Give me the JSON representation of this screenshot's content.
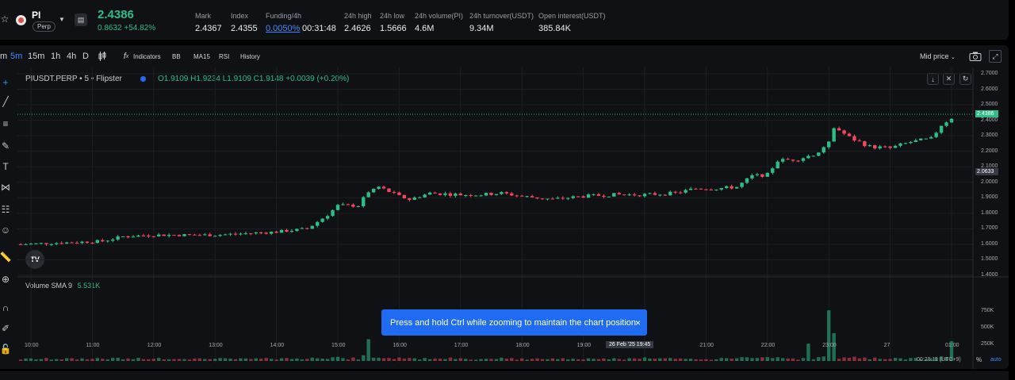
{
  "header": {
    "symbol": "PI",
    "contract_type": "Perp",
    "last_price": "2.4386",
    "change": "0.8632 +54.82%",
    "metrics": [
      {
        "label": "Mark",
        "value": "2.4367"
      },
      {
        "label": "Index",
        "value": "2.4355"
      },
      {
        "label": "Funding/4h",
        "value": "0.0050%",
        "countdown": "00:31:48"
      },
      {
        "label": "24h high",
        "value": "2.4626"
      },
      {
        "label": "24h low",
        "value": "1.5666"
      },
      {
        "label": "24h volume(PI)",
        "value": "4.6M"
      },
      {
        "label": "24h turnover(USDT)",
        "value": "9.34M"
      },
      {
        "label": "Open interest(USDT)",
        "value": "385.84K"
      }
    ]
  },
  "toolbar": {
    "timeframes": [
      "m",
      "5m",
      "15m",
      "1h",
      "4h",
      "D"
    ],
    "active_timeframe": "5m",
    "indicators_label": "Indicators",
    "studies": [
      "BB",
      "MA15",
      "RSI",
      "History"
    ],
    "price_mode": "Mid price"
  },
  "legend": {
    "title": "PIUSDT.PERP • 5 • Flipster",
    "ohlc": "O1.9109 H1.9234 L1.9109 C1.9148 +0.0039 (+0.20%)",
    "volume_label": "Volume SMA 9",
    "volume_value": "5.531K"
  },
  "price_axis": {
    "ticks": [
      "2.7000",
      "2.6000",
      "2.5000",
      "2.4000",
      "2.3000",
      "2.2000",
      "2.1000",
      "2.0000",
      "1.9000",
      "1.8000",
      "1.7000",
      "1.6000",
      "1.5000",
      "1.4000"
    ],
    "last_price_tag": "2.4386",
    "crosshair_tag": "2.0633"
  },
  "volume_axis": {
    "ticks": [
      "750K",
      "500K",
      "250K"
    ]
  },
  "time_axis": {
    "ticks": [
      "10:00",
      "11:00",
      "12:00",
      "13:00",
      "14:00",
      "15:00",
      "16:00",
      "17:00",
      "18:00",
      "19:00",
      "21:00",
      "22:00",
      "23:00",
      "27",
      "01:00"
    ],
    "crosshair_label": "26 Feb '25   19:45"
  },
  "footer": {
    "clock": "00:28:11 (UTC+9)",
    "percent": "%",
    "auto": "auto"
  },
  "toast": {
    "message": "Press and hold Ctrl while zooming to maintain the chart position",
    "close": "×"
  },
  "colors": {
    "up": "#2ebd85",
    "down": "#f6465d",
    "panel": "#101114",
    "accent": "#1f6bf2"
  },
  "chart_data": {
    "type": "candlestick",
    "symbol": "PIUSDT.PERP",
    "interval": "5",
    "ylim": [
      1.4,
      2.7
    ],
    "close_path": [
      [
        "09:50",
        1.6
      ],
      [
        "10:30",
        1.61
      ],
      [
        "11:10",
        1.62
      ],
      [
        "11:30",
        1.65
      ],
      [
        "12:00",
        1.66
      ],
      [
        "12:30",
        1.66
      ],
      [
        "13:00",
        1.66
      ],
      [
        "13:30",
        1.67
      ],
      [
        "14:00",
        1.68
      ],
      [
        "14:30",
        1.7
      ],
      [
        "14:50",
        1.79
      ],
      [
        "15:00",
        1.85
      ],
      [
        "15:20",
        1.85
      ],
      [
        "15:30",
        1.94
      ],
      [
        "15:40",
        1.97
      ],
      [
        "16:00",
        1.91
      ],
      [
        "16:10",
        1.89
      ],
      [
        "16:30",
        1.93
      ],
      [
        "17:00",
        1.92
      ],
      [
        "17:20",
        1.92
      ],
      [
        "17:40",
        1.93
      ],
      [
        "18:00",
        1.91
      ],
      [
        "18:30",
        1.89
      ],
      [
        "19:00",
        1.91
      ],
      [
        "19:30",
        1.92
      ],
      [
        "20:00",
        1.92
      ],
      [
        "20:30",
        1.93
      ],
      [
        "20:50",
        1.96
      ],
      [
        "21:10",
        1.96
      ],
      [
        "21:30",
        1.97
      ],
      [
        "21:45",
        2.04
      ],
      [
        "22:00",
        2.05
      ],
      [
        "22:10",
        2.14
      ],
      [
        "22:30",
        2.15
      ],
      [
        "22:50",
        2.19
      ],
      [
        "23:00",
        2.27
      ],
      [
        "23:05",
        2.36
      ],
      [
        "23:20",
        2.29
      ],
      [
        "23:40",
        2.23
      ],
      [
        "24:00",
        2.22
      ],
      [
        "24:20",
        2.26
      ],
      [
        "24:40",
        2.28
      ],
      [
        "24:50",
        2.37
      ],
      [
        "25:05",
        2.44
      ]
    ],
    "volume_spikes_k": [
      [
        "15:30",
        300
      ],
      [
        "22:40",
        310
      ],
      [
        "23:00",
        750
      ],
      [
        "23:05",
        420
      ],
      [
        "25:00",
        300
      ]
    ]
  }
}
